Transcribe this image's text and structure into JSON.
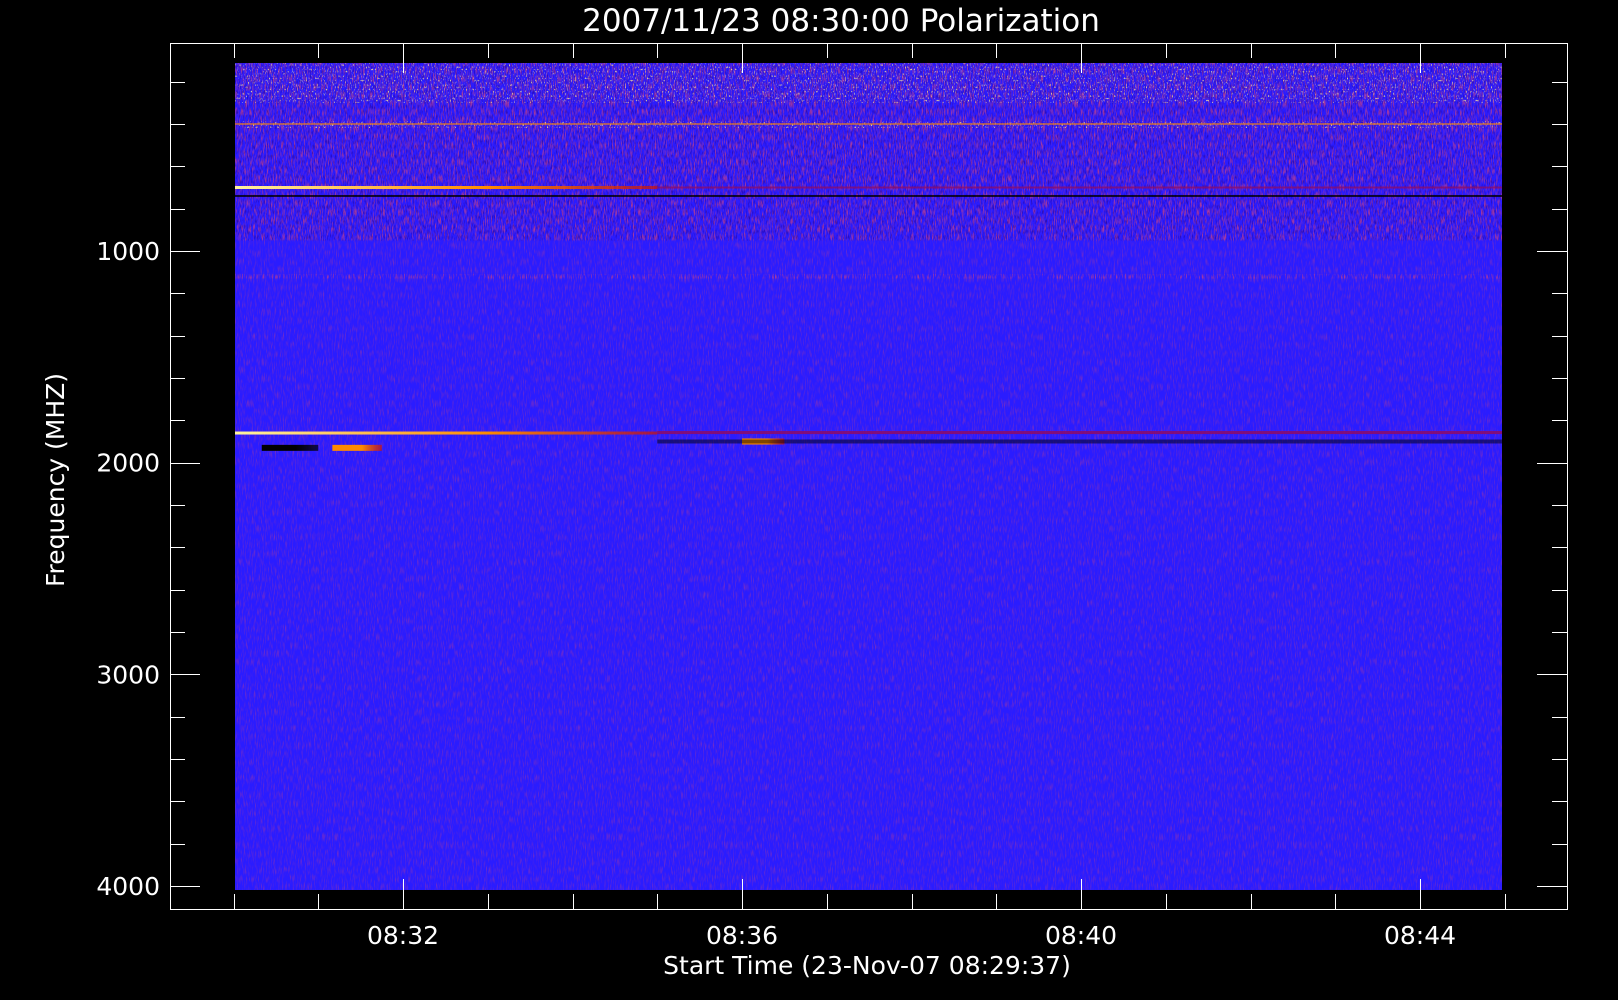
{
  "chart_data": {
    "type": "heatmap",
    "title": "2007/11/23 08:30:00 Polarization",
    "xlabel": "Start Time (23-Nov-07 08:29:37)",
    "ylabel": "Frequency (MHZ)",
    "x_range": [
      "08:29:37",
      "08:45:00"
    ],
    "x_ticks": [
      "08:32",
      "08:36",
      "08:40",
      "08:44"
    ],
    "y_range": [
      100,
      4000
    ],
    "y_ticks": [
      1000,
      2000,
      3000,
      4000
    ],
    "y_inverted": true,
    "colormap": [
      "#000000",
      "#1a00b0",
      "#2a1cff",
      "#8a0c6e",
      "#d01400",
      "#ff8a00",
      "#fff4a0",
      "#ffffff"
    ],
    "background_level_color": "#2a1cff",
    "features": [
      {
        "kind": "noisy band",
        "freq_from_mhz": 100,
        "freq_to_mhz": 950,
        "time_from": "08:29:37",
        "time_to": "08:45:00"
      },
      {
        "kind": "bright line",
        "freq_mhz": 400,
        "time_from": "08:29:37",
        "time_to": "08:45:00"
      },
      {
        "kind": "bright line",
        "freq_mhz": 700,
        "time_from": "08:29:37",
        "time_to": "08:35:00"
      },
      {
        "kind": "bright line",
        "freq_mhz": 1860,
        "time_from": "08:29:37",
        "time_to": "08:35:00"
      },
      {
        "kind": "dark band",
        "freq_mhz": 1930,
        "time_from": "08:30:20",
        "time_to": "08:31:00"
      },
      {
        "kind": "hot spot",
        "freq_mhz": 1930,
        "time_from": "08:31:10",
        "time_to": "08:31:45"
      },
      {
        "kind": "hot spot",
        "freq_mhz": 1900,
        "time_from": "08:36:00",
        "time_to": "08:36:30"
      }
    ]
  }
}
